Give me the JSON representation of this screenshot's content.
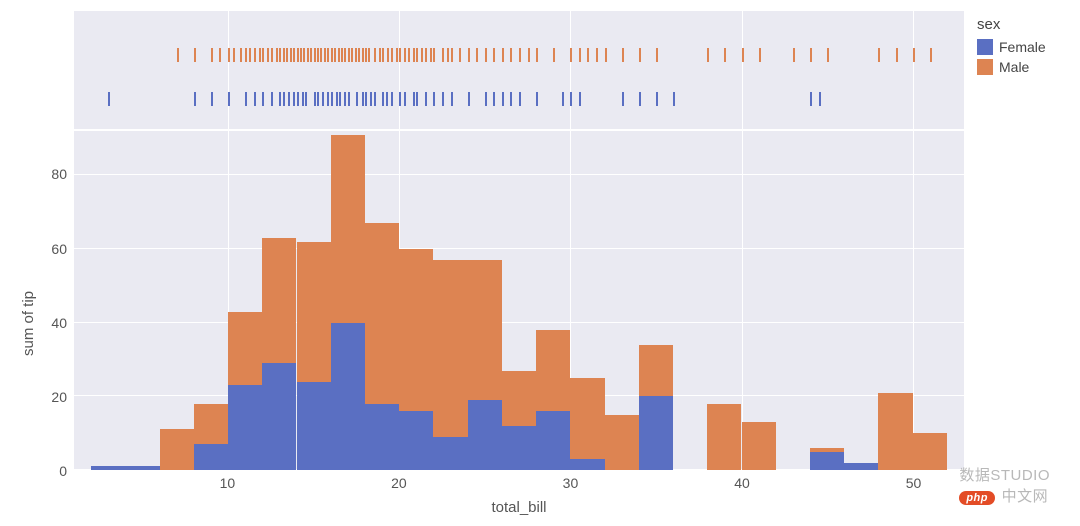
{
  "legend": {
    "title": "sex",
    "female": "Female",
    "male": "Male"
  },
  "axes": {
    "xlabel": "total_bill",
    "ylabel": "sum of tip",
    "x_ticks": [
      10,
      20,
      30,
      40,
      50
    ],
    "y_ticks": [
      0,
      20,
      40,
      60,
      80
    ]
  },
  "watermark": {
    "pill": "php",
    "text1": "数据STUDIO",
    "text2": "中文网"
  },
  "chart_data": {
    "type": "bar",
    "title": "",
    "xlabel": "total_bill",
    "ylabel": "sum of tip",
    "ylim": [
      0,
      92
    ],
    "xlim": [
      1,
      53
    ],
    "bin_width": 2,
    "categories": [
      3,
      5,
      7,
      9,
      11,
      13,
      15,
      17,
      19,
      21,
      23,
      25,
      27,
      29,
      31,
      33,
      35,
      37,
      39,
      41,
      43,
      45,
      47,
      49,
      51
    ],
    "series": [
      {
        "name": "Female",
        "values": [
          1,
          1,
          0,
          7,
          23,
          29,
          24,
          40,
          18,
          16,
          9,
          19,
          12,
          16,
          3,
          0,
          20,
          0,
          0,
          0,
          0,
          5,
          2,
          0,
          0
        ]
      },
      {
        "name": "Male",
        "values": [
          0,
          0,
          11,
          11,
          20,
          34,
          38,
          51,
          49,
          44,
          48,
          38,
          15,
          22,
          22,
          15,
          14,
          0,
          18,
          13,
          0,
          1,
          0,
          21,
          10
        ]
      }
    ],
    "rug": {
      "Female": [
        3,
        8,
        9,
        10,
        11,
        11.5,
        12,
        12.5,
        13,
        13.2,
        13.5,
        13.8,
        14,
        14.3,
        14.5,
        15,
        15.2,
        15.5,
        15.8,
        16,
        16.3,
        16.5,
        16.8,
        17,
        17.5,
        17.8,
        18,
        18.3,
        18.5,
        19,
        19.2,
        19.5,
        20,
        20.3,
        20.8,
        21,
        21.5,
        22,
        22.5,
        23,
        24,
        25,
        25.5,
        26,
        26.5,
        27,
        28,
        29.5,
        30,
        30.5,
        33,
        34,
        35,
        36,
        44,
        44.5
      ],
      "Male": [
        7,
        8,
        9,
        9.5,
        10,
        10.3,
        10.7,
        11,
        11.2,
        11.5,
        11.8,
        12,
        12.3,
        12.5,
        12.8,
        13,
        13.2,
        13.4,
        13.6,
        13.8,
        14,
        14.2,
        14.4,
        14.6,
        14.8,
        15,
        15.2,
        15.4,
        15.6,
        15.8,
        16,
        16.2,
        16.4,
        16.6,
        16.8,
        17,
        17.2,
        17.4,
        17.6,
        17.8,
        18,
        18.2,
        18.5,
        18.8,
        19,
        19.3,
        19.5,
        19.8,
        20,
        20.3,
        20.5,
        20.8,
        21,
        21.3,
        21.5,
        21.8,
        22,
        22.5,
        22.8,
        23,
        23.5,
        24,
        24.5,
        25,
        25.5,
        26,
        26.5,
        27,
        27.5,
        28,
        29,
        30,
        30.5,
        31,
        31.5,
        32,
        33,
        34,
        35,
        38,
        39,
        40,
        41,
        43,
        44,
        45,
        48,
        49,
        50,
        51
      ]
    }
  }
}
